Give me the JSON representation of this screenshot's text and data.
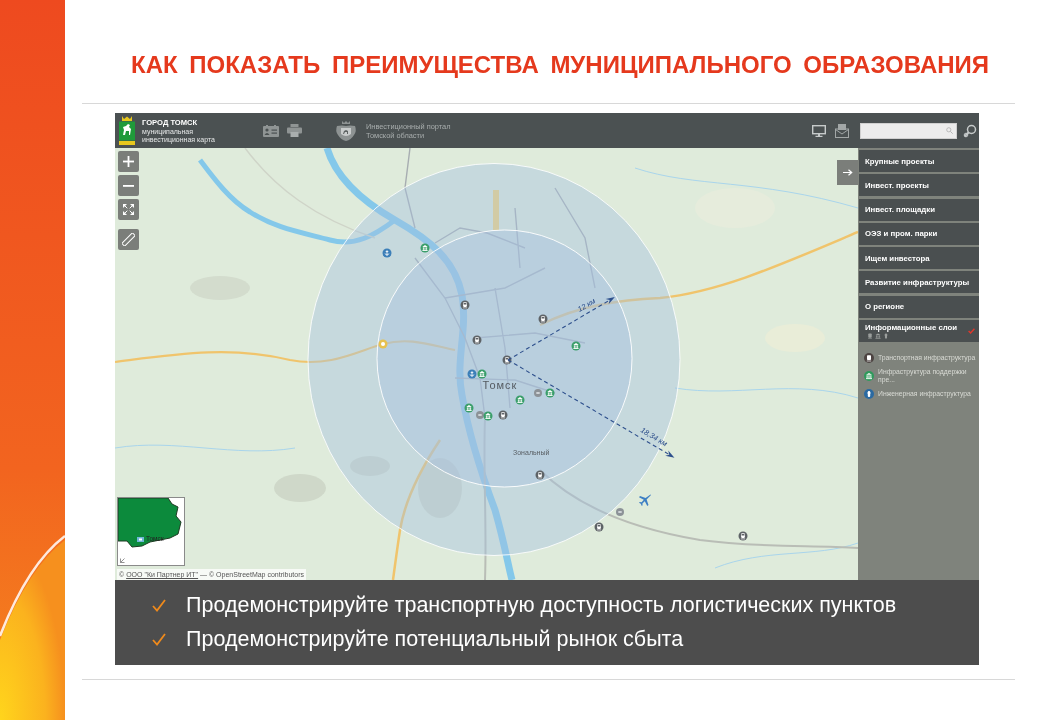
{
  "slide": {
    "title": "КАК ПОКАЗАТЬ ПРЕИМУЩЕСТВА МУНИЦИПАЛЬНОГО ОБРАЗОВАНИЯ"
  },
  "header": {
    "brand_title": "ГОРОД ТОМСК",
    "brand_subtitle": [
      "муниципальная",
      "инвестиционная карта"
    ],
    "portal": [
      "Инвестиционный портал",
      "Томской области"
    ]
  },
  "map": {
    "city_label": "Томск",
    "place_label": "Зональный",
    "distances": [
      {
        "kind": "inner",
        "label": "12 км"
      },
      {
        "kind": "outer",
        "label": "18,34 км"
      }
    ],
    "minimap": {
      "label": "Томск"
    },
    "attribution": {
      "prefix": "©",
      "link": "ООО \"Ки Партнер ИТ\"",
      "suffix": "— © OpenStreetMap contributors"
    }
  },
  "sidebar": {
    "items": [
      {
        "label": "Крупные проекты",
        "expanded": false
      },
      {
        "label": "Инвест. проекты",
        "expanded": false
      },
      {
        "label": "Инвест. площадки",
        "expanded": false
      },
      {
        "label": "ОЭЗ и пром. парки",
        "expanded": false
      },
      {
        "label": "Ищем инвестора",
        "expanded": false
      },
      {
        "label": "Развитие инфраструктуры",
        "expanded": false
      },
      {
        "label": "О регионе",
        "expanded": false
      },
      {
        "label": "Информационные слои",
        "expanded": true,
        "children": [
          {
            "label": "Транспортная инфраструктура",
            "kind": "transport",
            "color": "#4d4442"
          },
          {
            "label": "Инфраструктура поддержки пре...",
            "kind": "support",
            "color": "#2f9a5c"
          },
          {
            "label": "Инженерная инфраструктура",
            "kind": "engineering",
            "color": "#2b6aa2"
          }
        ]
      }
    ]
  },
  "notes": {
    "bullets": [
      "Продемонстрируйте транспортную доступность логистических пунктов",
      "Продемонстрируйте потенциальный рынок сбыта"
    ]
  }
}
